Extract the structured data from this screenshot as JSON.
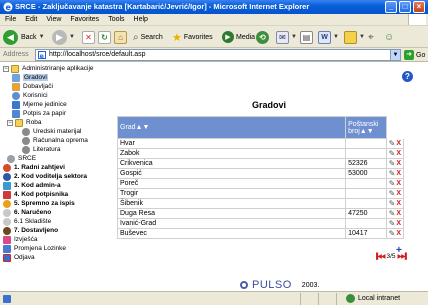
{
  "window": {
    "title": "SRCE - Zaključavanje katastra [Kartabarić/Jevrić/Igor] - Microsoft Internet Explorer"
  },
  "menu": [
    "File",
    "Edit",
    "View",
    "Favorites",
    "Tools",
    "Help"
  ],
  "toolbar": {
    "back_label": "Back",
    "search_label": "Search",
    "favorites_label": "Favorites",
    "media_label": "Media"
  },
  "address": {
    "label": "Address",
    "url": "http://localhost/srce/default.asp",
    "go_label": "Go"
  },
  "tree": {
    "root": "Administriranje aplikacije",
    "items": [
      "Gradovi",
      "Dobavljači",
      "Korisnici",
      "Mjerne jedinice",
      "Potpis za papir",
      "Roba",
      "Uredski materijal",
      "Računalna oprema",
      "Literatura",
      "SRCE",
      "1. Radni zahtjevi",
      "2. Kod voditelja sektora",
      "3. Kod admin-a",
      "4. Kod potpisnika",
      "5. Spremno za ispis",
      "6. Naručeno",
      "6.1 Skladište",
      "7. Dostavljeno",
      "Izvješća",
      "Promjena Lozinke",
      "Odjava"
    ]
  },
  "page": {
    "title": "Gradovi"
  },
  "grid": {
    "headers": {
      "grad": "Grad▲▼",
      "postanski_broj": "Poštanski broj▲▼"
    },
    "rows": [
      {
        "grad": "Hvar",
        "broj": ""
      },
      {
        "grad": "Zabok",
        "broj": ""
      },
      {
        "grad": "Crikvenica",
        "broj": "52326"
      },
      {
        "grad": "Gospić",
        "broj": "53000"
      },
      {
        "grad": "Poreč",
        "broj": ""
      },
      {
        "grad": "Trogir",
        "broj": ""
      },
      {
        "grad": "Šibenik",
        "broj": ""
      },
      {
        "grad": "Duga Resa",
        "broj": "47250"
      },
      {
        "grad": "Ivanić-Grad",
        "broj": ""
      },
      {
        "grad": "Buševec",
        "broj": "10417"
      }
    ],
    "add_label": "+",
    "pager": {
      "text": "3/5"
    }
  },
  "footer": {
    "brand": "PULSO",
    "year": "2003."
  },
  "status": {
    "zone": "Local intranet"
  }
}
